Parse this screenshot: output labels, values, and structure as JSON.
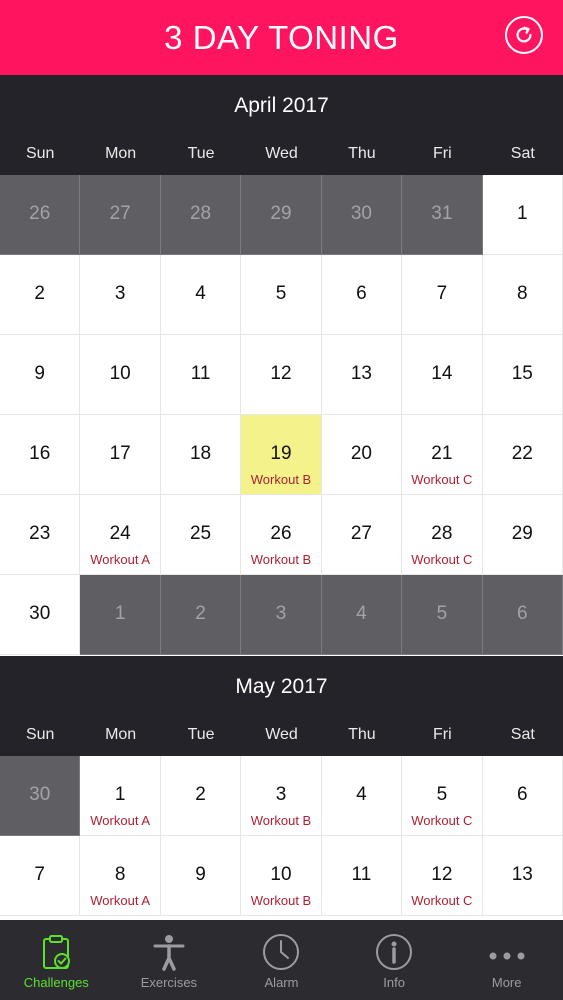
{
  "header": {
    "title": "3 DAY TONING",
    "refresh_icon": "refresh-icon"
  },
  "weekdays": [
    "Sun",
    "Mon",
    "Tue",
    "Wed",
    "Thu",
    "Fri",
    "Sat"
  ],
  "months": [
    {
      "title": "April 2017",
      "cells": [
        {
          "day": "26",
          "outside": true
        },
        {
          "day": "27",
          "outside": true
        },
        {
          "day": "28",
          "outside": true
        },
        {
          "day": "29",
          "outside": true
        },
        {
          "day": "30",
          "outside": true
        },
        {
          "day": "31",
          "outside": true
        },
        {
          "day": "1"
        },
        {
          "day": "2"
        },
        {
          "day": "3"
        },
        {
          "day": "4"
        },
        {
          "day": "5"
        },
        {
          "day": "6"
        },
        {
          "day": "7"
        },
        {
          "day": "8"
        },
        {
          "day": "9"
        },
        {
          "day": "10"
        },
        {
          "day": "11"
        },
        {
          "day": "12"
        },
        {
          "day": "13"
        },
        {
          "day": "14"
        },
        {
          "day": "15"
        },
        {
          "day": "16"
        },
        {
          "day": "17"
        },
        {
          "day": "18"
        },
        {
          "day": "19",
          "today": true,
          "workout": "Workout B"
        },
        {
          "day": "20"
        },
        {
          "day": "21",
          "workout": "Workout C"
        },
        {
          "day": "22"
        },
        {
          "day": "23"
        },
        {
          "day": "24",
          "workout": "Workout A"
        },
        {
          "day": "25"
        },
        {
          "day": "26",
          "workout": "Workout B"
        },
        {
          "day": "27"
        },
        {
          "day": "28",
          "workout": "Workout C"
        },
        {
          "day": "29"
        },
        {
          "day": "30"
        },
        {
          "day": "1",
          "outside": true
        },
        {
          "day": "2",
          "outside": true
        },
        {
          "day": "3",
          "outside": true
        },
        {
          "day": "4",
          "outside": true
        },
        {
          "day": "5",
          "outside": true
        },
        {
          "day": "6",
          "outside": true
        }
      ]
    },
    {
      "title": "May 2017",
      "cells": [
        {
          "day": "30",
          "outside": true
        },
        {
          "day": "1",
          "workout": "Workout A"
        },
        {
          "day": "2"
        },
        {
          "day": "3",
          "workout": "Workout B"
        },
        {
          "day": "4"
        },
        {
          "day": "5",
          "workout": "Workout C"
        },
        {
          "day": "6"
        },
        {
          "day": "7"
        },
        {
          "day": "8",
          "workout": "Workout A"
        },
        {
          "day": "9"
        },
        {
          "day": "10",
          "workout": "Workout B"
        },
        {
          "day": "11"
        },
        {
          "day": "12",
          "workout": "Workout C"
        },
        {
          "day": "13"
        }
      ]
    }
  ],
  "tabs": [
    {
      "label": "Challenges",
      "icon": "clipboard-check-icon",
      "active": true
    },
    {
      "label": "Exercises",
      "icon": "person-icon"
    },
    {
      "label": "Alarm",
      "icon": "clock-icon"
    },
    {
      "label": "Info",
      "icon": "info-icon"
    },
    {
      "label": "More",
      "icon": "more-dots-icon"
    }
  ],
  "colors": {
    "header": "#ff1460",
    "month_header": "#232329",
    "today": "#f4f28a",
    "workout_text": "#b01f35",
    "tab_active": "#5ce02e"
  }
}
